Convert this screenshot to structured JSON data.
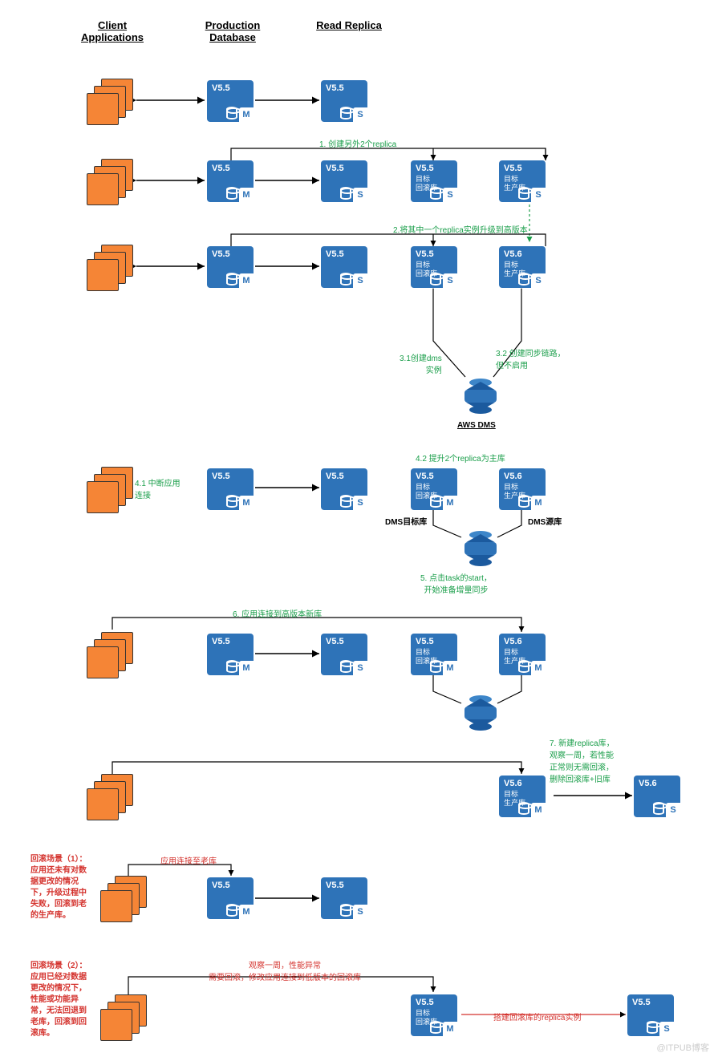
{
  "headers": {
    "client": "Client Applications",
    "prod": "Production Database",
    "replica": "Read Replica"
  },
  "versions": {
    "v55": "V5.5",
    "v56": "V5.6"
  },
  "subs": {
    "rollback": "目标\n回滚库",
    "prod": "目标\n生产库"
  },
  "badges": {
    "m": "M",
    "s": "S"
  },
  "steps": {
    "s1": "1. 创建另外2个replica",
    "s2": "2.将其中一个replica实例升级到高版本",
    "s31": "3.1创建dms\n实例",
    "s32": "3.2 创建同步链路，\n但不启用",
    "s41": "4.1 中断应用\n连接",
    "s42": "4.2 提升2个replica为主库",
    "s5": "5. 点击task的start，\n开始准备增量同步",
    "s6": "6. 应用连接到高版本新库",
    "s7": "7. 新建replica库，\n观察一周，若性能\n正常则无需回滚，\n删除回滚库+旧库"
  },
  "labels": {
    "aws_dms": "AWS DMS",
    "dms_target": "DMS目标库",
    "dms_source": "DMS源库",
    "app_to_old": "应用连接至老库",
    "observe": "观察一周，性能异常\n需要回滚，修改应用连接到低版本的回滚库",
    "build_rollback_replica": "搭建回滚库的replica实例"
  },
  "scenarios": {
    "sc1": "回滚场景（1）：应用还未有对数据更改的情况下，升级过程中失败，回滚到老的生产库。",
    "sc2": "回滚场景（2）：应用已经对数据更改的情况下，性能或功能异常，无法回退到老库，回滚到回滚库。"
  },
  "watermark": "@ITPUB博客"
}
